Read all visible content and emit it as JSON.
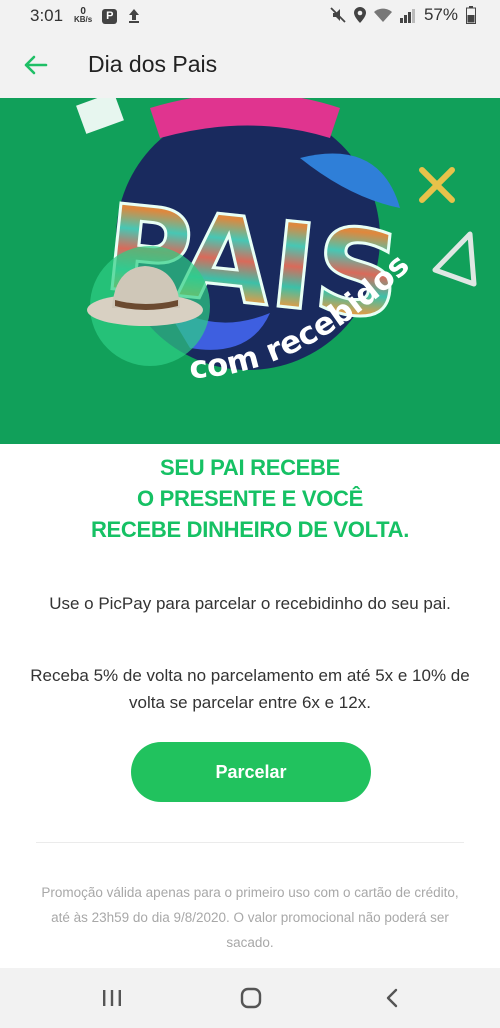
{
  "status_bar": {
    "time": "3:01",
    "net_speed_unit": "KB/s",
    "net_speed_value": "0",
    "app_badge": "P",
    "battery": "57%",
    "icons": [
      "mute-icon",
      "location-icon",
      "wifi-icon",
      "signal-icon",
      "battery-icon"
    ]
  },
  "app_bar": {
    "title": "Dia dos Pais",
    "back_icon": "arrow-left-icon",
    "accent": "#1fbf66"
  },
  "hero": {
    "word": "PAIS",
    "tagline": "com recebidos",
    "background": "#11a05a"
  },
  "content": {
    "headline": [
      "SEU PAI RECEBE",
      "O PRESENTE E VOCÊ",
      "RECEBE DINHEIRO DE VOLTA."
    ],
    "paragraph_1": "Use o PicPay para parcelar o recebidinho do seu pai.",
    "paragraph_2": "Receba 5% de volta no parcelamento em até 5x e 10% de volta se parcelar entre 6x e 12x.",
    "cta_label": "Parcelar",
    "disclaimer": "Promoção válida apenas para o primeiro uso com o cartão de crédito, até às 23h59 do dia 9/8/2020. O valor promocional não poderá ser sacado."
  },
  "nav_bar": {
    "icons": [
      "recent-apps-icon",
      "home-icon",
      "back-nav-icon"
    ]
  }
}
